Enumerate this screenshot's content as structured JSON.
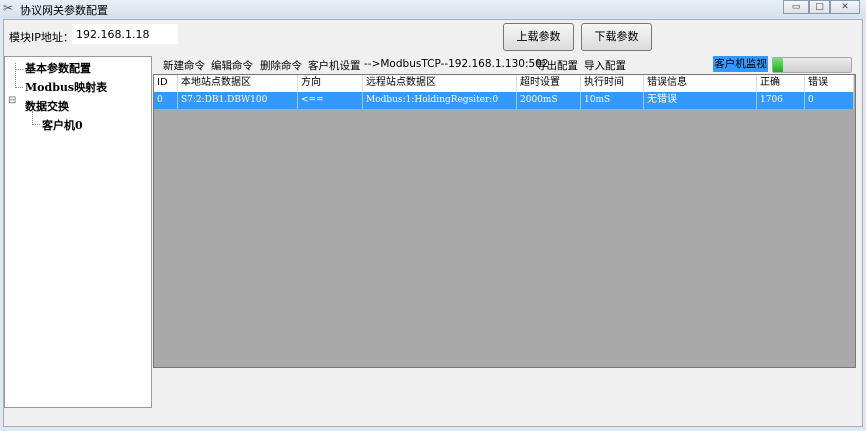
{
  "window": {
    "title": "协议网关参数配置",
    "minimize": "▭",
    "maximize": "□",
    "close": "✕"
  },
  "header": {
    "ip_label": "模块IP地址：",
    "ip_value": "192.168.1.18",
    "upload": "上载参数",
    "download": "下载参数"
  },
  "tree": {
    "items": [
      "基本参数配置",
      "Modbus映射表",
      "数据交换",
      "客户机0"
    ],
    "expander": "⊟"
  },
  "toolbar": {
    "new": "新建命令",
    "edit": "编辑命令",
    "delete": "删除命令",
    "client_settings": "客户机设置",
    "connection": "-->ModbusTCP--192.168.1.130:502",
    "export": "导出配置",
    "import": "导入配置",
    "monitor": "客户机监视",
    "monitor_progress": 0.13
  },
  "grid": {
    "columns": [
      "ID",
      "本地站点数据区",
      "方向",
      "远程站点数据区",
      "超时设置",
      "执行时间",
      "错误信息",
      "正确",
      "错误"
    ],
    "rows": [
      [
        "0",
        "S7:2:DB1.DBW100",
        "<==",
        "Modbus:1:HoldingRegsiter:0",
        "2000mS",
        "10mS",
        "无错误",
        "1706",
        "0"
      ]
    ]
  }
}
